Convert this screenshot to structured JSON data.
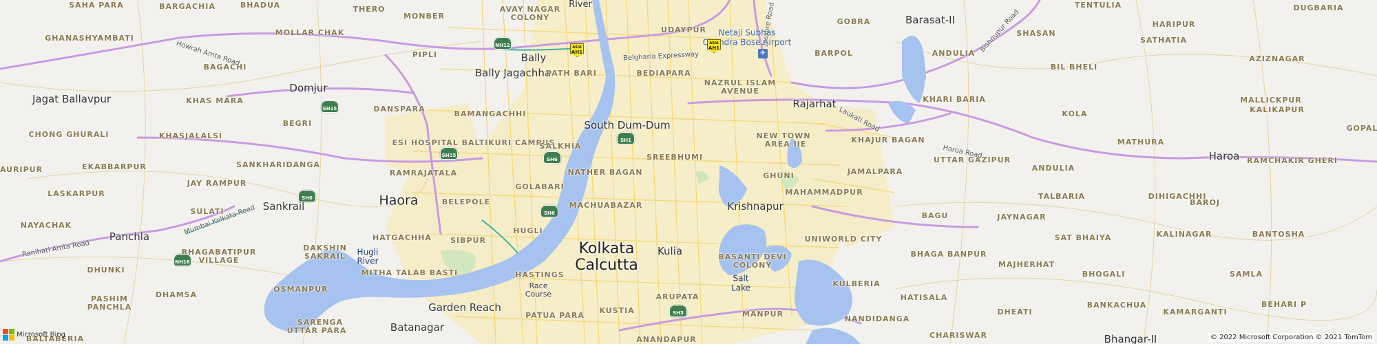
{
  "map": {
    "provider_logo": "Microsoft Bing",
    "copyright": "© 2022 Microsoft Corporation © 2021 TomTom",
    "marker_icon": "map-pin-icon",
    "marker_color": "#2e5289",
    "water_color": "#a6c3ef",
    "highway_color": "#c89be0",
    "colors": {
      "background": "#f2f1ee",
      "urban": "#f6ecc4",
      "road_minor": "#f7d66b"
    }
  },
  "labels": {
    "saha_para": "SAHA PARA",
    "bargachia": "BARGACHIA",
    "bhadua": "BHADUA",
    "thero": "THERO",
    "monber": "MONBER",
    "avay_nagar": "AVAY NAGAR",
    "colony": "COLONY",
    "river_top": "River",
    "udaypur": "UDAYPUR",
    "gobra": "GOBRA",
    "barasat": "Barasat-II",
    "tentulia": "TENTULIA",
    "dugbaria": "DUGBARIA",
    "ghanashyambati": "GHANASHYAMBATI",
    "mollar_chak": "MOLLAR CHAK",
    "haripur": "HARIPUR",
    "shasan": "SHASAN",
    "sathatia": "SATHATIA",
    "aziznagar": "AZIZNAGAR",
    "bil_bheli": "BIL BHELI",
    "bally": "Bally",
    "pipli": "PIPLI",
    "bagachi": "BAGACHI",
    "barpol": "BARPOL",
    "andulia": "ANDULIA",
    "bally_jagachha": "Bally Jagachha",
    "path_bari": "PATH BARI",
    "bediapara": "BEDIAPARA",
    "nazrul_islam": "NAZRUL ISLAM",
    "avenue": "AVENUE",
    "domjur": "Domjur",
    "khas_mara": "KHAS MARA",
    "jagat_ballavpur": "Jagat Ballavpur",
    "dan_spara": "DANSPARA",
    "rajarhat": "Rajarhat",
    "khari_baria": "KHARI BARIA",
    "mallickpur": "MALLICKPUR",
    "kalikapur": "KALIKAPUR",
    "bamangachhi": "BAMANGACHHI",
    "begri": "BEGRI",
    "kola": "KOLA",
    "chong_ghurali": "CHONG GHURALI",
    "khasjalalsi": "KHASJALALSI",
    "esi_hospital": "ESI HOSPITAL BALTIKURI CAMPUS",
    "south_dum_dum": "South Dum-Dum",
    "new_town": "NEW TOWN",
    "area_iie": "AREA IIE",
    "khajur_bagan": "KHAJUR BAGAN",
    "mathura": "MATHURA",
    "haroa": "Haroa",
    "gopalp": "GOPALP",
    "salkhia": "SALKHIA",
    "uttar_gazipur": "UTTAR GAZIPUR",
    "ramchakir_gheri": "RAMCHAKIR GHERI",
    "gauripur": "GAURIPUR",
    "ekabbarpur": "EKABBARPUR",
    "sankharidanga": "SANKHARIDANGA",
    "sreebhumi": "SREEBHUMI",
    "nather_bagan": "NATHER BAGAN",
    "jamalpara": "JAMALPARA",
    "andulia2": "ANDULIA",
    "jay_rampur": "JAY RAMPUR",
    "ramrajatala": "RAMRAJATALA",
    "golabari": "GOLABARI",
    "ghuni": "GHUNI",
    "mahammadpur": "MAHAMMADPUR",
    "talbaria": "TALBARIA",
    "dihigachhi": "DIHIGACHHI",
    "laskarpur": "LASKARPUR",
    "haora": "Haora",
    "belepole": "BELEPOLE",
    "machuabazar": "MACHUABAZAR",
    "krishnapur": "Krishnapur",
    "baroj": "BAROJ",
    "sankrail": "Sankrail",
    "sulati": "SULATI",
    "jaynagar": "JAYNAGAR",
    "bagu": "BAGU",
    "hugli": "HUGLI",
    "nayachak": "NAYACHAK",
    "sibpur": "SIBPUR",
    "panchla": "Panchla",
    "uniworld_city": "UNIWORLD CITY",
    "sat_bhaiya": "SAT BHAIYA",
    "kalinagar": "KALINAGAR",
    "bantosha": "BANTOSHA",
    "kolkata": "Kolkata",
    "calcutta": "Calcutta",
    "kulia": "Kulia",
    "dakshin": "DAKSHIN",
    "sakrail": "SAKRAIL",
    "hatgachha": "HATGACHHA",
    "basanti_devi": "BASANTI DEVI",
    "colony2": "COLONY",
    "bhaga_banpur": "BHAGA BANPUR",
    "majherhat": "MAJHERHAT",
    "dhunki": "DHUNKI",
    "bhagabatipur": "BHAGABATIPUR",
    "village": "VILLAGE",
    "hugli_river": "Hugli",
    "river": "River",
    "salt_lake": "Salt",
    "lake": "Lake",
    "bhogali": "BHOGALI",
    "samla": "SAMLA",
    "mitha_talab": "MITHA TALAB BASTI",
    "hastings": "HASTINGS",
    "race": "Race",
    "course": "Course",
    "kulberia": "KULBERIA",
    "hatisala": "HATISALA",
    "osmanpur": "OSMANPUR",
    "dhamsa": "DHAMSA",
    "pashim": "PASHIM",
    "panchla2": "PANCHLA",
    "garden_reach": "Garden Reach",
    "patua_para": "PATUA PARA",
    "kustia": "KUSTIA",
    "arupata": "ARUPATA",
    "manpur": "MANPUR",
    "nandidanga": "NANDIDANGA",
    "dheati": "DHEATI",
    "bankachua": "BANKACHUA",
    "kamarganti": "KAMARGANTI",
    "behari_p": "BEHARI P",
    "sarenga": "SARENGA",
    "uttar_para": "UTTAR PARA",
    "batanagar": "Batanagar",
    "charisw": "CHARISWAR",
    "bhangar": "Bhangar-II",
    "baltaberia": "BALTABERIA",
    "anandapur": "ANANDAPUR"
  },
  "roads": {
    "howrah_amta": "Howrah Amta Road",
    "belgharia": "Belgharia Expressway",
    "jessore": "Jessore Road",
    "laukati": "Laukati Road",
    "haroa_road": "Haroa Road",
    "bishnupur": "Bishnupur Road",
    "mumbai_kolkata": "Mumbai Kolkata Road",
    "ranihati_amta": "Ranihati Amta Road"
  },
  "airport": {
    "name_line1": "Netaji Subhas",
    "name_line2": "Chandra Bose Airport",
    "icon": "airplane-icon"
  },
  "shields": {
    "nh12": "NH12",
    "sh15a": "SH15",
    "sh15b": "SH15",
    "sh1": "SH1",
    "sh6a": "SH6",
    "sh6b": "SH6",
    "sh6c": "SH6",
    "nh16": "NH16",
    "sh3": "SH3"
  },
  "ah_shields": {
    "ah1a": "AH1",
    "ah1b": "AH1",
    "top": "ASIA"
  }
}
